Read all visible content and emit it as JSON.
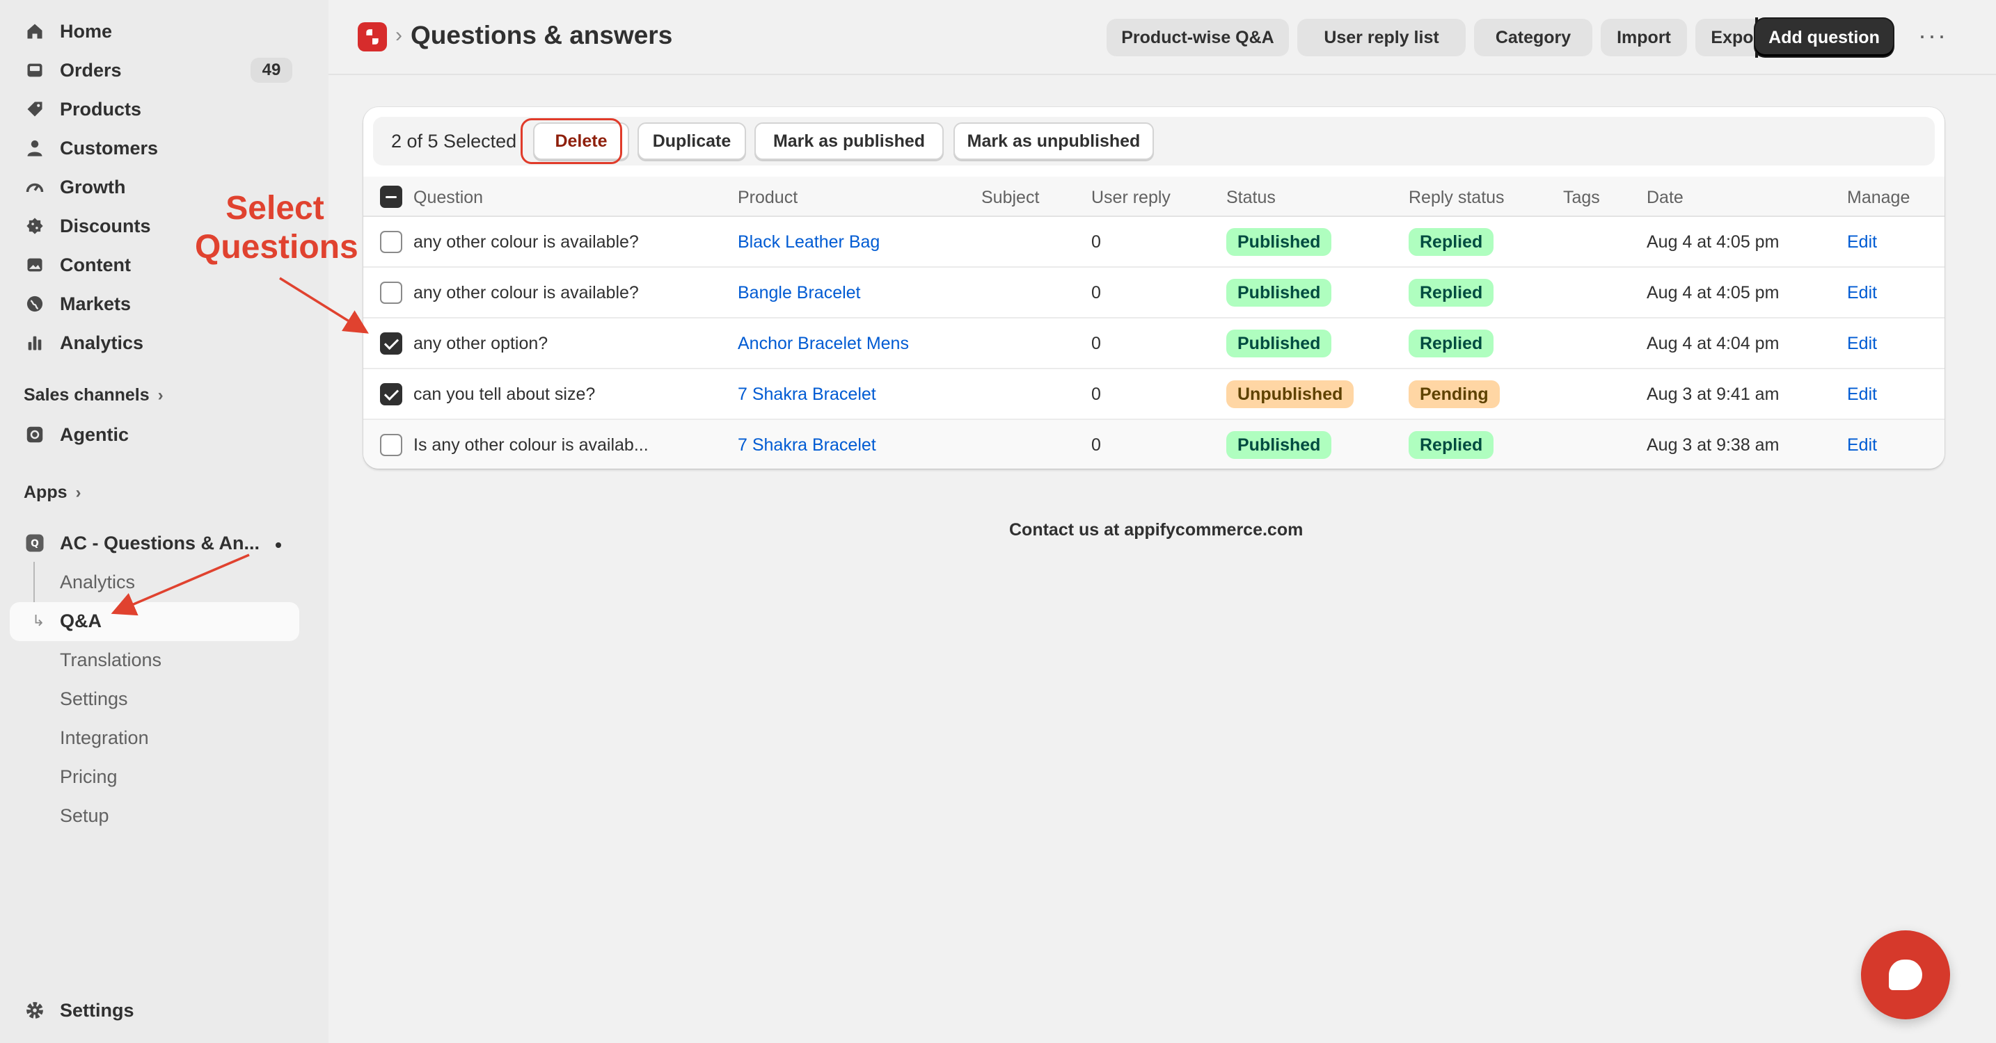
{
  "sidebar": {
    "items": [
      {
        "label": "Home",
        "icon": "home-icon"
      },
      {
        "label": "Orders",
        "icon": "inbox-icon",
        "badge": "49"
      },
      {
        "label": "Products",
        "icon": "tag-icon"
      },
      {
        "label": "Customers",
        "icon": "person-icon"
      },
      {
        "label": "Growth",
        "icon": "gauge-icon"
      },
      {
        "label": "Discounts",
        "icon": "discount-icon"
      },
      {
        "label": "Content",
        "icon": "image-icon"
      },
      {
        "label": "Markets",
        "icon": "globe-icon"
      },
      {
        "label": "Analytics",
        "icon": "bar-chart-icon"
      }
    ],
    "sales_channels": "Sales channels",
    "agentic": "Agentic",
    "apps": "Apps",
    "app_name": "AC - Questions & An...",
    "app_subitems": [
      "Analytics",
      "Q&A",
      "Translations",
      "Settings",
      "Integration",
      "Pricing",
      "Setup"
    ],
    "settings": "Settings"
  },
  "header": {
    "title": "Questions & answers",
    "buttons": [
      "Product-wise Q&A",
      "User reply list",
      "Category",
      "Import",
      "Export"
    ],
    "primary_button": "Add question"
  },
  "bulk_actions": {
    "selected_text": "2 of 5 Selected",
    "delete": "Delete",
    "duplicate": "Duplicate",
    "mark_published": "Mark as published",
    "mark_unpublished": "Mark as unpublished"
  },
  "table": {
    "columns": [
      "Question",
      "Product",
      "Subject",
      "User reply",
      "Status",
      "Reply status",
      "Tags",
      "Date",
      "Manage"
    ],
    "rows": [
      {
        "question": "any other colour is available?",
        "product": "Black Leather Bag",
        "subject": "",
        "user_reply": "0",
        "status": "Published",
        "reply_status": "Replied",
        "tags": "",
        "date": "Aug 4 at 4:05 pm",
        "manage": "Edit",
        "checked": false
      },
      {
        "question": "any other colour is available?",
        "product": "Bangle Bracelet",
        "subject": "",
        "user_reply": "0",
        "status": "Published",
        "reply_status": "Replied",
        "tags": "",
        "date": "Aug 4 at 4:05 pm",
        "manage": "Edit",
        "checked": false
      },
      {
        "question": "any other option?",
        "product": "Anchor Bracelet Mens",
        "subject": "",
        "user_reply": "0",
        "status": "Published",
        "reply_status": "Replied",
        "tags": "",
        "date": "Aug 4 at 4:04 pm",
        "manage": "Edit",
        "checked": true
      },
      {
        "question": "can you tell about size?",
        "product": "7 Shakra Bracelet",
        "subject": "",
        "user_reply": "0",
        "status": "Unpublished",
        "reply_status": "Pending",
        "tags": "",
        "date": "Aug 3 at 9:41 am",
        "manage": "Edit",
        "checked": true
      },
      {
        "question": "Is any other colour is availab...",
        "product": "7 Shakra Bracelet",
        "subject": "",
        "user_reply": "0",
        "status": "Published",
        "reply_status": "Replied",
        "tags": "",
        "date": "Aug 3 at 9:38 am",
        "manage": "Edit",
        "checked": false
      }
    ]
  },
  "footer": {
    "contact": "Contact us at appifycommerce.com"
  },
  "annotation": {
    "line1": "Select",
    "line2": "Questions",
    "color": "#e0422f"
  },
  "colors": {
    "primary": "#303030",
    "link": "#005bd3",
    "published_bg": "#affebf",
    "unpublished_bg": "#ffd6a4",
    "chat": "#d6392b"
  }
}
